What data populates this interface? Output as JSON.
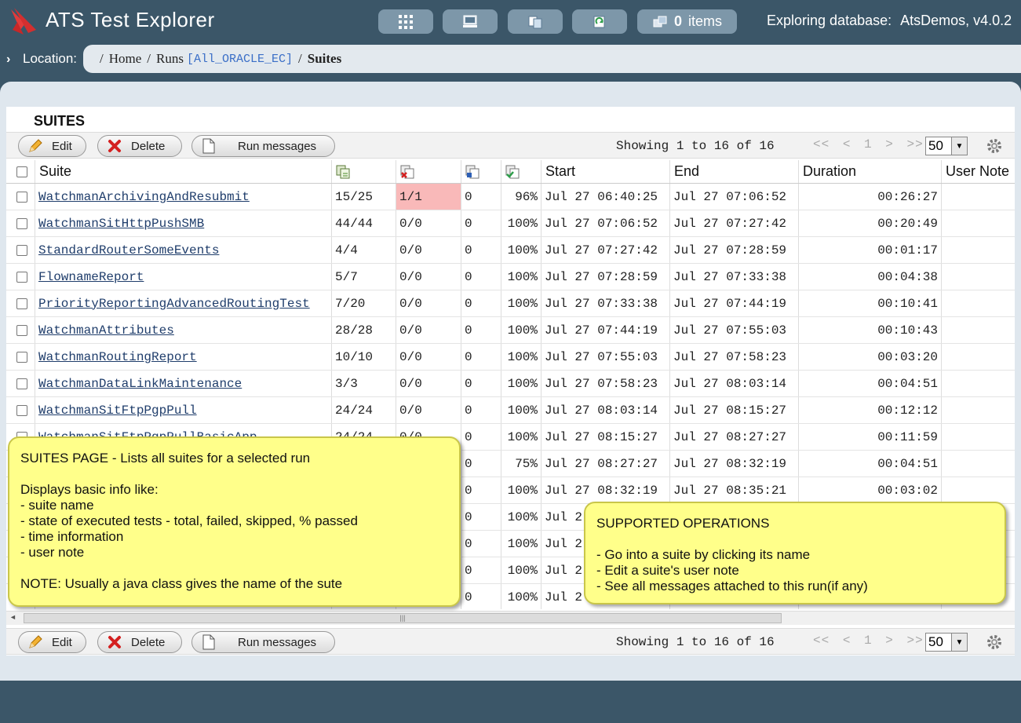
{
  "app": {
    "title": "ATS Test Explorer"
  },
  "header": {
    "items_count": "0",
    "items_label": "items",
    "db_label": "Exploring database:",
    "db_name": "AtsDemos, v4.0.2"
  },
  "location": {
    "label": "Location:",
    "crumbs": [
      "Home",
      "Runs"
    ],
    "run_id": "[All_ORACLE_EC]",
    "current": "Suites"
  },
  "page": {
    "title": "SUITES"
  },
  "toolbar": {
    "edit": "Edit",
    "delete": "Delete",
    "run_messages": "Run messages",
    "showing": "Showing 1 to 16 of 16",
    "pager_first": "<<",
    "pager_prev": "<",
    "pager_page": "1",
    "pager_next": ">",
    "pager_last": ">>",
    "page_size": "50"
  },
  "columns": {
    "suite": "Suite",
    "start": "Start",
    "end": "End",
    "duration": "Duration",
    "user_note": "User Note"
  },
  "rows": [
    {
      "name": "WatchmanArchivingAndResubmit",
      "total": "15/25",
      "failed": "1/1",
      "skipped": "0",
      "passed": "96%",
      "start": "Jul 27 06:40:25",
      "end": "Jul 27 07:06:52",
      "duration": "00:26:27",
      "failed_highlight": true
    },
    {
      "name": "WatchmanSitHttpPushSMB",
      "total": "44/44",
      "failed": "0/0",
      "skipped": "0",
      "passed": "100%",
      "start": "Jul 27 07:06:52",
      "end": "Jul 27 07:27:42",
      "duration": "00:20:49"
    },
    {
      "name": "StandardRouterSomeEvents",
      "total": "4/4",
      "failed": "0/0",
      "skipped": "0",
      "passed": "100%",
      "start": "Jul 27 07:27:42",
      "end": "Jul 27 07:28:59",
      "duration": "00:01:17"
    },
    {
      "name": "FlownameReport",
      "total": "5/7",
      "failed": "0/0",
      "skipped": "0",
      "passed": "100%",
      "start": "Jul 27 07:28:59",
      "end": "Jul 27 07:33:38",
      "duration": "00:04:38"
    },
    {
      "name": "PriorityReportingAdvancedRoutingTest",
      "total": "7/20",
      "failed": "0/0",
      "skipped": "0",
      "passed": "100%",
      "start": "Jul 27 07:33:38",
      "end": "Jul 27 07:44:19",
      "duration": "00:10:41"
    },
    {
      "name": "WatchmanAttributes",
      "total": "28/28",
      "failed": "0/0",
      "skipped": "0",
      "passed": "100%",
      "start": "Jul 27 07:44:19",
      "end": "Jul 27 07:55:03",
      "duration": "00:10:43"
    },
    {
      "name": "WatchmanRoutingReport",
      "total": "10/10",
      "failed": "0/0",
      "skipped": "0",
      "passed": "100%",
      "start": "Jul 27 07:55:03",
      "end": "Jul 27 07:58:23",
      "duration": "00:03:20"
    },
    {
      "name": "WatchmanDataLinkMaintenance",
      "total": "3/3",
      "failed": "0/0",
      "skipped": "0",
      "passed": "100%",
      "start": "Jul 27 07:58:23",
      "end": "Jul 27 08:03:14",
      "duration": "00:04:51"
    },
    {
      "name": "WatchmanSitFtpPgpPull",
      "total": "24/24",
      "failed": "0/0",
      "skipped": "0",
      "passed": "100%",
      "start": "Jul 27 08:03:14",
      "end": "Jul 27 08:15:27",
      "duration": "00:12:12"
    },
    {
      "name": "WatchmanSitFtpPgpPullBasicApp",
      "total": "24/24",
      "failed": "0/0",
      "skipped": "0",
      "passed": "100%",
      "start": "Jul 27 08:15:27",
      "end": "Jul 27 08:27:27",
      "duration": "00:11:59"
    },
    {
      "name": "",
      "total": "",
      "failed": "",
      "skipped": "0",
      "passed": "75%",
      "start": "Jul 27 08:27:27",
      "end": "Jul 27 08:32:19",
      "duration": "00:04:51"
    },
    {
      "name": "",
      "total": "",
      "failed": "",
      "skipped": "0",
      "passed": "100%",
      "start": "Jul 27 08:32:19",
      "end": "Jul 27 08:35:21",
      "duration": "00:03:02"
    },
    {
      "name": "",
      "total": "",
      "failed": "",
      "skipped": "0",
      "passed": "100%",
      "start": "Jul 2",
      "end": "",
      "duration": ""
    },
    {
      "name": "",
      "total": "",
      "failed": "",
      "skipped": "0",
      "passed": "100%",
      "start": "Jul 2",
      "end": "",
      "duration": ""
    },
    {
      "name": "",
      "total": "",
      "failed": "",
      "skipped": "0",
      "passed": "100%",
      "start": "Jul 2",
      "end": "",
      "duration": ""
    },
    {
      "name": "",
      "total": "",
      "failed": "",
      "skipped": "0",
      "passed": "100%",
      "start": "Jul 2",
      "end": "",
      "duration": ""
    }
  ],
  "callouts": {
    "suites_page": "SUITES PAGE - Lists all suites for a selected run\n\nDisplays basic info like:\n- suite name\n- state of executed tests - total, failed, skipped, % passed\n- time information\n- user note\n\nNOTE: Usually a java class gives the name of the sute",
    "supported_ops": "SUPPORTED OPERATIONS\n\n- Go into a suite by clicking its name\n- Edit a suite's user note\n- See all messages attached to this run(if any)"
  },
  "colors": {
    "background": "#3b5668",
    "panel": "#dfe7ee",
    "failed_highlight": "#f9b9b9",
    "callout": "#ffff8a"
  }
}
